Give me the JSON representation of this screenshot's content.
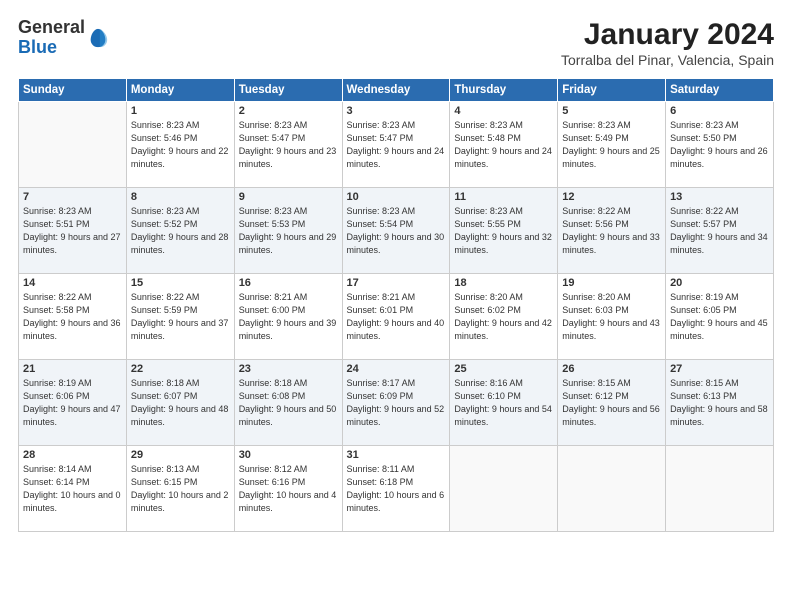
{
  "logo": {
    "general": "General",
    "blue": "Blue"
  },
  "header": {
    "month": "January 2024",
    "location": "Torralba del Pinar, Valencia, Spain"
  },
  "weekdays": [
    "Sunday",
    "Monday",
    "Tuesday",
    "Wednesday",
    "Thursday",
    "Friday",
    "Saturday"
  ],
  "weeks": [
    [
      {
        "day": "",
        "sunrise": "",
        "sunset": "",
        "daylight": ""
      },
      {
        "day": "1",
        "sunrise": "Sunrise: 8:23 AM",
        "sunset": "Sunset: 5:46 PM",
        "daylight": "Daylight: 9 hours and 22 minutes."
      },
      {
        "day": "2",
        "sunrise": "Sunrise: 8:23 AM",
        "sunset": "Sunset: 5:47 PM",
        "daylight": "Daylight: 9 hours and 23 minutes."
      },
      {
        "day": "3",
        "sunrise": "Sunrise: 8:23 AM",
        "sunset": "Sunset: 5:47 PM",
        "daylight": "Daylight: 9 hours and 24 minutes."
      },
      {
        "day": "4",
        "sunrise": "Sunrise: 8:23 AM",
        "sunset": "Sunset: 5:48 PM",
        "daylight": "Daylight: 9 hours and 24 minutes."
      },
      {
        "day": "5",
        "sunrise": "Sunrise: 8:23 AM",
        "sunset": "Sunset: 5:49 PM",
        "daylight": "Daylight: 9 hours and 25 minutes."
      },
      {
        "day": "6",
        "sunrise": "Sunrise: 8:23 AM",
        "sunset": "Sunset: 5:50 PM",
        "daylight": "Daylight: 9 hours and 26 minutes."
      }
    ],
    [
      {
        "day": "7",
        "sunrise": "Sunrise: 8:23 AM",
        "sunset": "Sunset: 5:51 PM",
        "daylight": "Daylight: 9 hours and 27 minutes."
      },
      {
        "day": "8",
        "sunrise": "Sunrise: 8:23 AM",
        "sunset": "Sunset: 5:52 PM",
        "daylight": "Daylight: 9 hours and 28 minutes."
      },
      {
        "day": "9",
        "sunrise": "Sunrise: 8:23 AM",
        "sunset": "Sunset: 5:53 PM",
        "daylight": "Daylight: 9 hours and 29 minutes."
      },
      {
        "day": "10",
        "sunrise": "Sunrise: 8:23 AM",
        "sunset": "Sunset: 5:54 PM",
        "daylight": "Daylight: 9 hours and 30 minutes."
      },
      {
        "day": "11",
        "sunrise": "Sunrise: 8:23 AM",
        "sunset": "Sunset: 5:55 PM",
        "daylight": "Daylight: 9 hours and 32 minutes."
      },
      {
        "day": "12",
        "sunrise": "Sunrise: 8:22 AM",
        "sunset": "Sunset: 5:56 PM",
        "daylight": "Daylight: 9 hours and 33 minutes."
      },
      {
        "day": "13",
        "sunrise": "Sunrise: 8:22 AM",
        "sunset": "Sunset: 5:57 PM",
        "daylight": "Daylight: 9 hours and 34 minutes."
      }
    ],
    [
      {
        "day": "14",
        "sunrise": "Sunrise: 8:22 AM",
        "sunset": "Sunset: 5:58 PM",
        "daylight": "Daylight: 9 hours and 36 minutes."
      },
      {
        "day": "15",
        "sunrise": "Sunrise: 8:22 AM",
        "sunset": "Sunset: 5:59 PM",
        "daylight": "Daylight: 9 hours and 37 minutes."
      },
      {
        "day": "16",
        "sunrise": "Sunrise: 8:21 AM",
        "sunset": "Sunset: 6:00 PM",
        "daylight": "Daylight: 9 hours and 39 minutes."
      },
      {
        "day": "17",
        "sunrise": "Sunrise: 8:21 AM",
        "sunset": "Sunset: 6:01 PM",
        "daylight": "Daylight: 9 hours and 40 minutes."
      },
      {
        "day": "18",
        "sunrise": "Sunrise: 8:20 AM",
        "sunset": "Sunset: 6:02 PM",
        "daylight": "Daylight: 9 hours and 42 minutes."
      },
      {
        "day": "19",
        "sunrise": "Sunrise: 8:20 AM",
        "sunset": "Sunset: 6:03 PM",
        "daylight": "Daylight: 9 hours and 43 minutes."
      },
      {
        "day": "20",
        "sunrise": "Sunrise: 8:19 AM",
        "sunset": "Sunset: 6:05 PM",
        "daylight": "Daylight: 9 hours and 45 minutes."
      }
    ],
    [
      {
        "day": "21",
        "sunrise": "Sunrise: 8:19 AM",
        "sunset": "Sunset: 6:06 PM",
        "daylight": "Daylight: 9 hours and 47 minutes."
      },
      {
        "day": "22",
        "sunrise": "Sunrise: 8:18 AM",
        "sunset": "Sunset: 6:07 PM",
        "daylight": "Daylight: 9 hours and 48 minutes."
      },
      {
        "day": "23",
        "sunrise": "Sunrise: 8:18 AM",
        "sunset": "Sunset: 6:08 PM",
        "daylight": "Daylight: 9 hours and 50 minutes."
      },
      {
        "day": "24",
        "sunrise": "Sunrise: 8:17 AM",
        "sunset": "Sunset: 6:09 PM",
        "daylight": "Daylight: 9 hours and 52 minutes."
      },
      {
        "day": "25",
        "sunrise": "Sunrise: 8:16 AM",
        "sunset": "Sunset: 6:10 PM",
        "daylight": "Daylight: 9 hours and 54 minutes."
      },
      {
        "day": "26",
        "sunrise": "Sunrise: 8:15 AM",
        "sunset": "Sunset: 6:12 PM",
        "daylight": "Daylight: 9 hours and 56 minutes."
      },
      {
        "day": "27",
        "sunrise": "Sunrise: 8:15 AM",
        "sunset": "Sunset: 6:13 PM",
        "daylight": "Daylight: 9 hours and 58 minutes."
      }
    ],
    [
      {
        "day": "28",
        "sunrise": "Sunrise: 8:14 AM",
        "sunset": "Sunset: 6:14 PM",
        "daylight": "Daylight: 10 hours and 0 minutes."
      },
      {
        "day": "29",
        "sunrise": "Sunrise: 8:13 AM",
        "sunset": "Sunset: 6:15 PM",
        "daylight": "Daylight: 10 hours and 2 minutes."
      },
      {
        "day": "30",
        "sunrise": "Sunrise: 8:12 AM",
        "sunset": "Sunset: 6:16 PM",
        "daylight": "Daylight: 10 hours and 4 minutes."
      },
      {
        "day": "31",
        "sunrise": "Sunrise: 8:11 AM",
        "sunset": "Sunset: 6:18 PM",
        "daylight": "Daylight: 10 hours and 6 minutes."
      },
      {
        "day": "",
        "sunrise": "",
        "sunset": "",
        "daylight": ""
      },
      {
        "day": "",
        "sunrise": "",
        "sunset": "",
        "daylight": ""
      },
      {
        "day": "",
        "sunrise": "",
        "sunset": "",
        "daylight": ""
      }
    ]
  ]
}
